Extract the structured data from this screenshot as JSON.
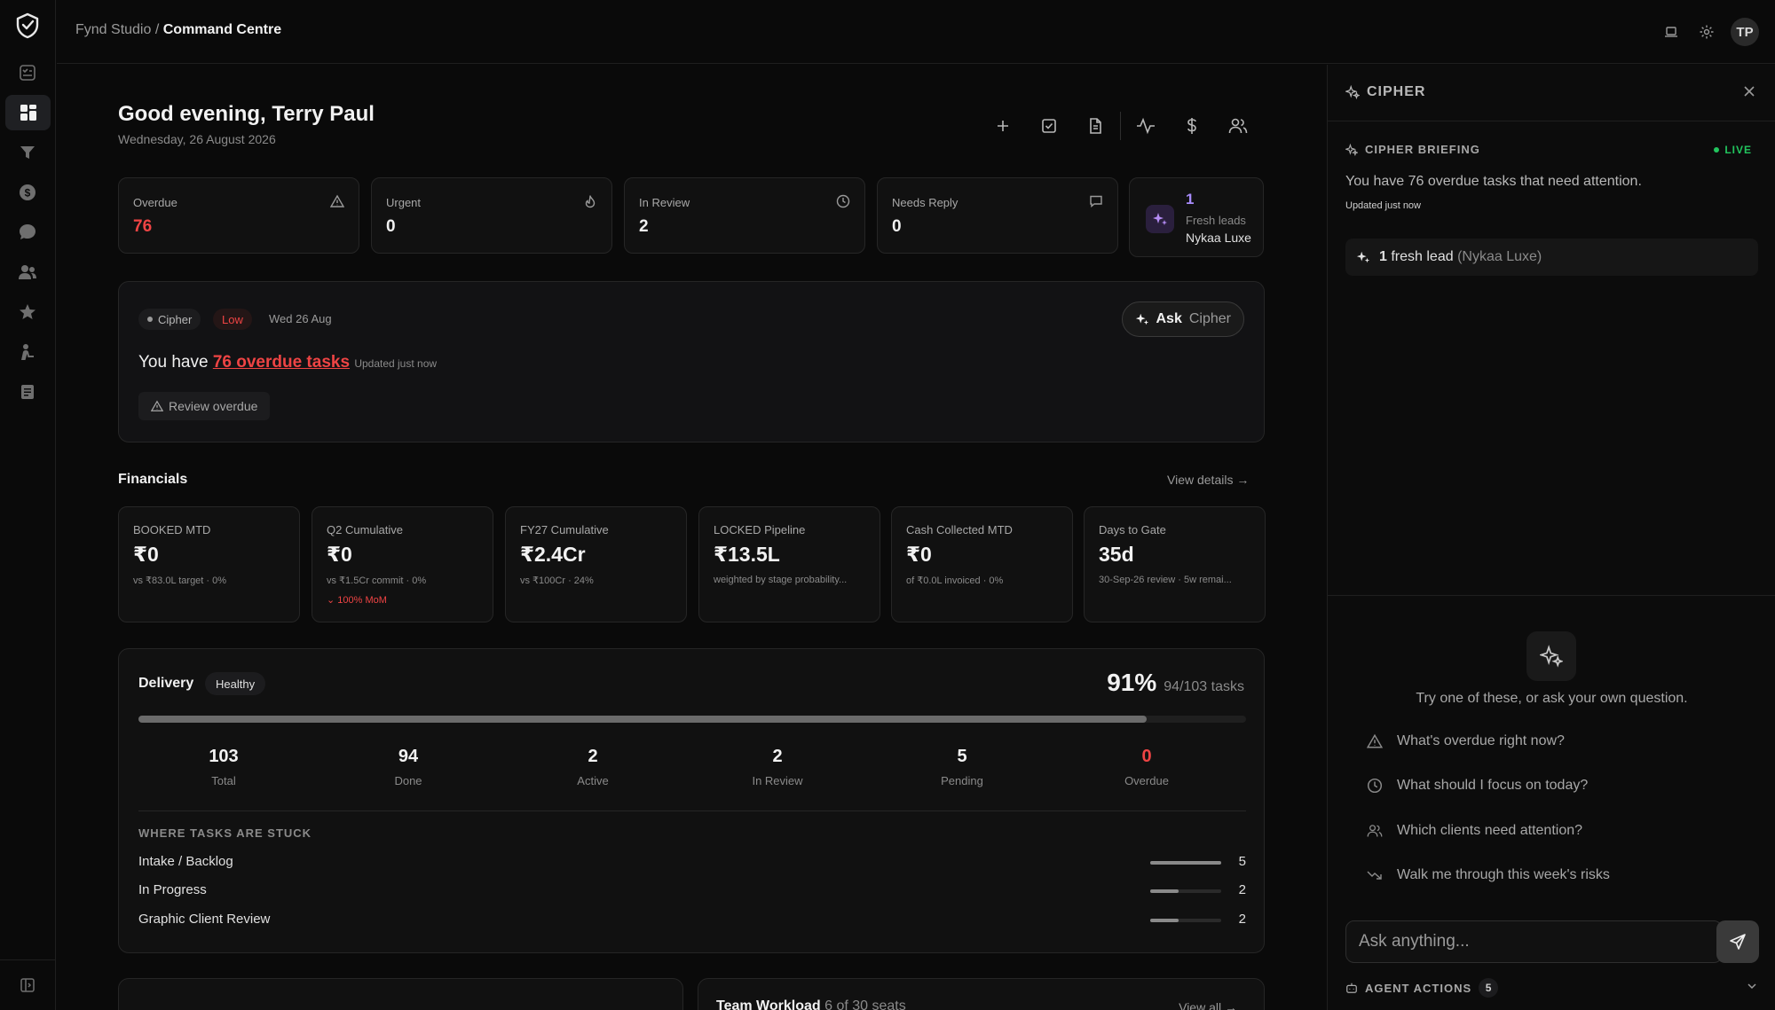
{
  "header": {
    "breadcrumb_parent": "Fynd Studio",
    "breadcrumb_sep": " / ",
    "breadcrumb_current": "Command Centre",
    "avatar_initials": "TP"
  },
  "sidebar": {
    "items": [
      "tasks-icon",
      "dashboard-icon",
      "funnel-icon",
      "dollar-icon",
      "chat-icon",
      "users-icon",
      "star-icon",
      "person-icon",
      "document-icon"
    ],
    "active": "dashboard-icon"
  },
  "greeting": {
    "title": "Good evening, Terry Paul",
    "date": "Wednesday, 26 August 2026"
  },
  "stats": [
    {
      "label": "Overdue",
      "value": "76",
      "icon": "warning-icon"
    },
    {
      "label": "Urgent",
      "value": "0",
      "icon": "flame-icon"
    },
    {
      "label": "In Review",
      "value": "2",
      "icon": "clock-icon"
    },
    {
      "label": "Needs Reply",
      "value": "0",
      "icon": "message-icon"
    }
  ],
  "leads": {
    "count": "1",
    "label": "Fresh leads",
    "client": "Nykaa Luxe"
  },
  "briefing": {
    "source": "Cipher",
    "priority": "Low",
    "date": "Wed 26 Aug",
    "ask_prefix": "Ask",
    "ask_label": "Cipher",
    "text_prefix": "You have ",
    "text_link": "76 overdue tasks",
    "updated": "Updated just now",
    "review_label": "Review overdue"
  },
  "financials": {
    "title": "Financials",
    "view_details": "View details →",
    "cards": [
      {
        "label": "BOOKED MTD",
        "value": "₹0",
        "sub": "vs ₹83.0L target · 0%",
        "trend": ""
      },
      {
        "label": "Q2 Cumulative",
        "value": "₹0",
        "sub": "vs ₹1.5Cr commit · 0%",
        "trend": "100% MoM"
      },
      {
        "label": "FY27 Cumulative",
        "value": "₹2.4Cr",
        "sub": "vs ₹100Cr · 24%",
        "trend": ""
      },
      {
        "label": "LOCKED Pipeline",
        "value": "₹13.5L",
        "sub": "weighted by stage probability...",
        "trend": ""
      },
      {
        "label": "Cash Collected MTD",
        "value": "₹0",
        "sub": "of ₹0.0L invoiced · 0%",
        "trend": ""
      },
      {
        "label": "Days to Gate",
        "value": "35d",
        "sub": "30-Sep-26 review · 5w remai...",
        "trend": ""
      }
    ]
  },
  "delivery": {
    "title": "Delivery",
    "badge": "Healthy",
    "percent": "91%",
    "percent_value": 91,
    "tasks": "94/103 tasks",
    "stats": [
      {
        "value": "103",
        "label": "Total"
      },
      {
        "value": "94",
        "label": "Done"
      },
      {
        "value": "2",
        "label": "Active"
      },
      {
        "value": "2",
        "label": "In Review"
      },
      {
        "value": "5",
        "label": "Pending"
      },
      {
        "value": "0",
        "label": "Overdue"
      }
    ],
    "stuck_title": "WHERE TASKS ARE STUCK",
    "stuck": [
      {
        "name": "Intake / Backlog",
        "count": "5",
        "fraction": 1.0
      },
      {
        "name": "In Progress",
        "count": "2",
        "fraction": 0.4
      },
      {
        "name": "Graphic Client Review",
        "count": "2",
        "fraction": 0.4
      }
    ]
  },
  "team_workload": {
    "title": "Team Workload",
    "seats": "6 of 30 seats",
    "view_all": "View all →"
  },
  "cipher_panel": {
    "title": "CIPHER",
    "briefing_title": "CIPHER BRIEFING",
    "live": "LIVE",
    "briefing_text": "You have 76 overdue tasks that need attention.",
    "updated": "Updated just now",
    "lead_count": "1",
    "lead_text": "fresh lead",
    "lead_client": "(Nykaa Luxe)",
    "try_text": "Try one of these, or ask your own question.",
    "suggestions": [
      {
        "icon": "warning-icon",
        "text": "What's overdue right now?"
      },
      {
        "icon": "clock-icon",
        "text": "What should I focus on today?"
      },
      {
        "icon": "users-icon",
        "text": "Which clients need attention?"
      },
      {
        "icon": "trend-down-icon",
        "text": "Walk me through this week's risks"
      }
    ],
    "input_placeholder": "Ask anything...",
    "agent_actions": "AGENT ACTIONS",
    "agent_count": "5"
  }
}
